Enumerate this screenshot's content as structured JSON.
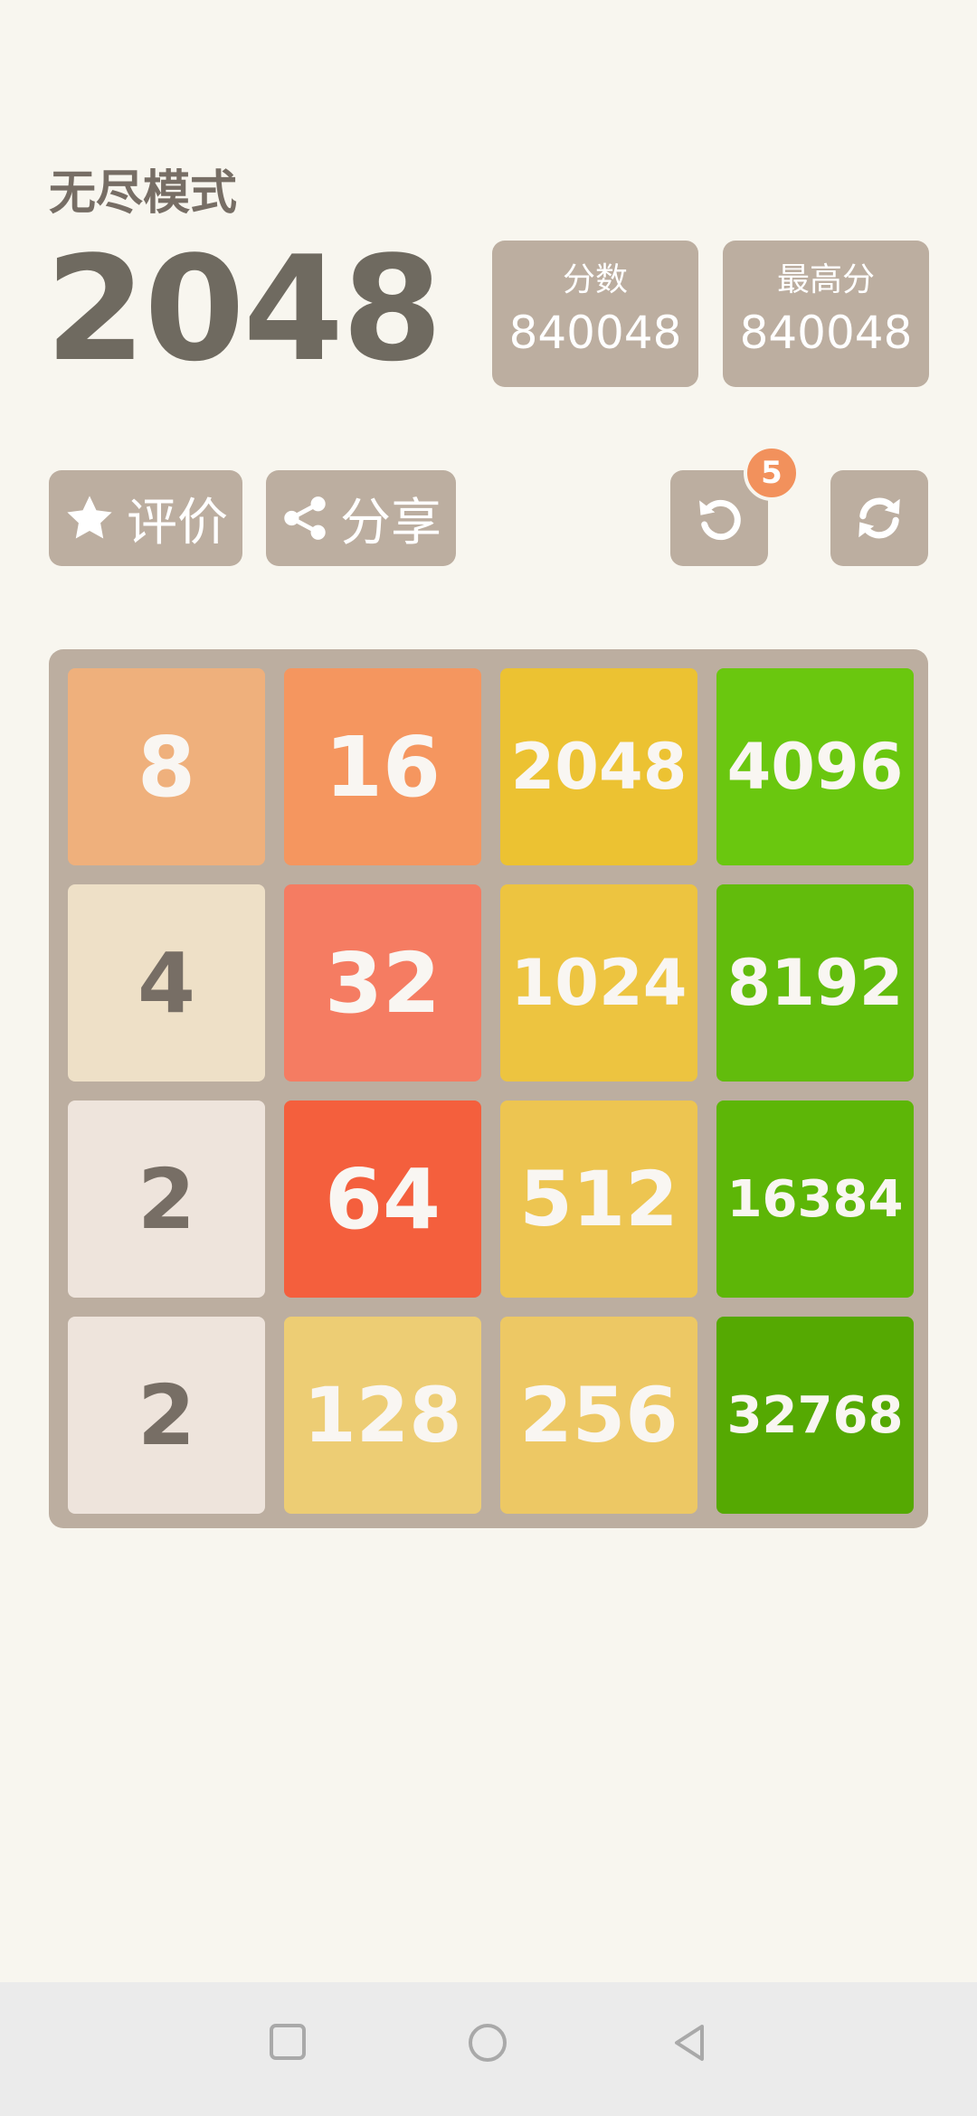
{
  "header": {
    "mode_title": "无尽模式",
    "game_title": "2048"
  },
  "scores": {
    "current_label": "分数",
    "current_value": "840048",
    "best_label": "最高分",
    "best_value": "840048"
  },
  "actions": {
    "rate_label": "评价",
    "share_label": "分享",
    "undo_badge": "5"
  },
  "icons": {
    "rate": "star-icon",
    "share": "share-icon",
    "undo": "undo-icon",
    "restart": "restart-icon"
  },
  "board": {
    "rows": [
      [
        "8",
        "16",
        "2048",
        "4096"
      ],
      [
        "4",
        "32",
        "1024",
        "8192"
      ],
      [
        "2",
        "64",
        "512",
        "16384"
      ],
      [
        "2",
        "128",
        "256",
        "32768"
      ]
    ],
    "colors": {
      "2": "#eee4dc",
      "4": "#eee0c7",
      "8": "#efb07c",
      "16": "#f5965f",
      "32": "#f57c62",
      "64": "#f45f3d",
      "128": "#edcd74",
      "256": "#edc864",
      "512": "#edc551",
      "1024": "#edc440",
      "2048": "#ecc232",
      "4096": "#6ac70f",
      "8192": "#62bc0c",
      "16384": "#5db607",
      "32768": "#55a902"
    }
  },
  "colors": {
    "background": "#f8f6ef",
    "panel": "#bcaea0",
    "badge": "#f2915c",
    "title_text": "#776e65"
  },
  "navbar": {
    "icons": [
      "recent-apps-icon",
      "home-icon",
      "back-icon"
    ]
  }
}
